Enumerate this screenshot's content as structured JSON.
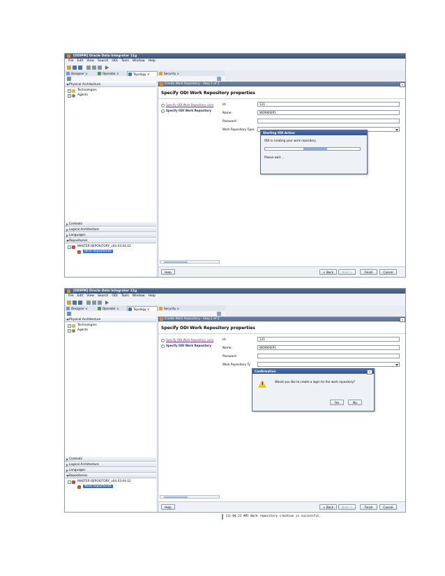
{
  "app": {
    "title": "[ODIPM] Oracle Data Integrator 11g",
    "menu": [
      "File",
      "Edit",
      "View",
      "Search",
      "ODI",
      "Tools",
      "Window",
      "Help"
    ],
    "tabs": [
      {
        "label": "Designer",
        "close": "×"
      },
      {
        "label": "Operator",
        "close": "×"
      },
      {
        "label": "Topology",
        "close": "×"
      },
      {
        "label": "Security",
        "close": "×"
      }
    ],
    "icon_colors": {
      "designer": "#6b9ad6",
      "operator": "#5d8f57",
      "topology": "#3f6fbf",
      "security": "#d8a23a"
    }
  },
  "left": {
    "physical_architecture": "Physical Architecture",
    "technologies": "Technologies",
    "agents": "Agents",
    "contexts": "Contexts",
    "logical_architecture": "Logical Architecture",
    "languages": "Languages",
    "repositories": "Repositories",
    "master_repo": "MASTER REPOSITORY_v04.03.04.02",
    "work_repos": "Work Repositories"
  },
  "wizard": {
    "title": "Create Work Repository - Step 2 of 2",
    "heading": "Specify ODI Work Repository properties",
    "step1": "Specify ODI Work Repository conn",
    "step2": "Specify ODI Work Repository",
    "id_label": "Id:",
    "id_value": "121",
    "name_label": "Name:",
    "name_value": "WORKREP1",
    "password_label": "Password:",
    "type_label": "Work Repository Type:",
    "type_label_short": "Work Repository Ty",
    "help": "Help",
    "back": "< Back",
    "next": "Next >",
    "finish": "Finish",
    "cancel": "Cancel",
    "close": "×"
  },
  "progress_dialog": {
    "title": "Starting ODI Action",
    "message": "ODI is creating your work repository",
    "wait": "Please wait ...",
    "progress_value": 0.25
  },
  "confirm_dialog": {
    "title": "Confirmation",
    "message": "Would you like to create a login for the work repository?",
    "yes": "Yes",
    "no": "No",
    "close": "×"
  },
  "log": {
    "line": "[11:04:22 AM] Work repository creation is successful."
  }
}
